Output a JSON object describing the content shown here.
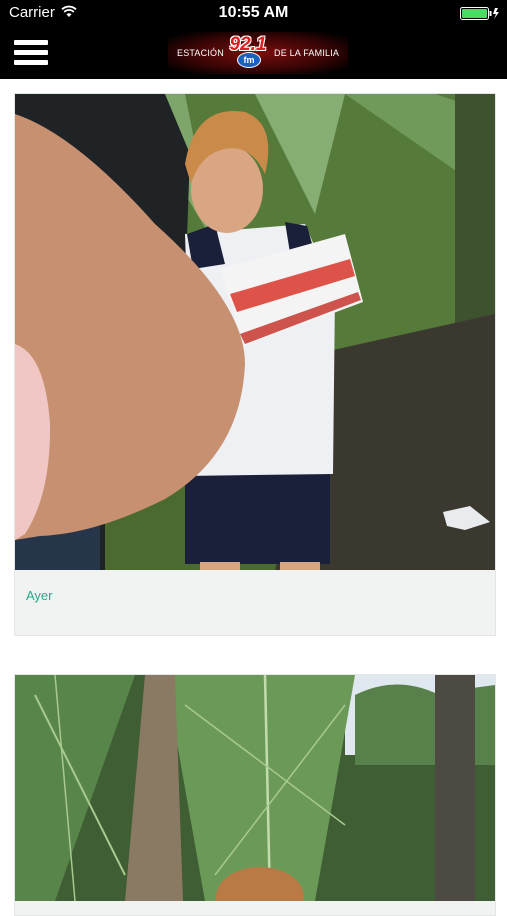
{
  "status_bar": {
    "carrier": "Carrier",
    "time": "10:55 AM",
    "icons": [
      "wifi-icon",
      "battery-icon"
    ],
    "battery_color": "#4cd964"
  },
  "header": {
    "menu_icon": "hamburger-menu-icon",
    "logo": {
      "left_text": "ESTACIÓN",
      "number": "92.1",
      "band": "fm",
      "right_text": "DE LA FAMILIA"
    },
    "background": "#000000"
  },
  "feed": {
    "posts": [
      {
        "date_label": "Ayer",
        "photo": "boy-holding-gift-box-photo"
      },
      {
        "date_label": "",
        "photo": "palm-trees-child-photo"
      }
    ],
    "accent_color": "#2aa689"
  }
}
